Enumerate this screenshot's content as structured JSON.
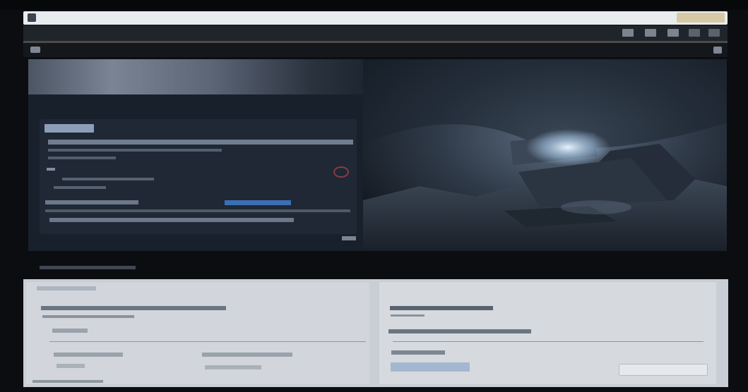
{
  "os": {
    "left": "",
    "right": ""
  },
  "browser": {
    "title": ""
  },
  "toolbar": {
    "label": ""
  },
  "hero": {
    "title": "",
    "subtitle": "",
    "tag": ""
  },
  "lower": {
    "right_heading": ""
  },
  "colors": {
    "accent_link": "#3b6fb5",
    "page_bg": "#0b0d11",
    "lower_bg": "#c9ced5"
  }
}
